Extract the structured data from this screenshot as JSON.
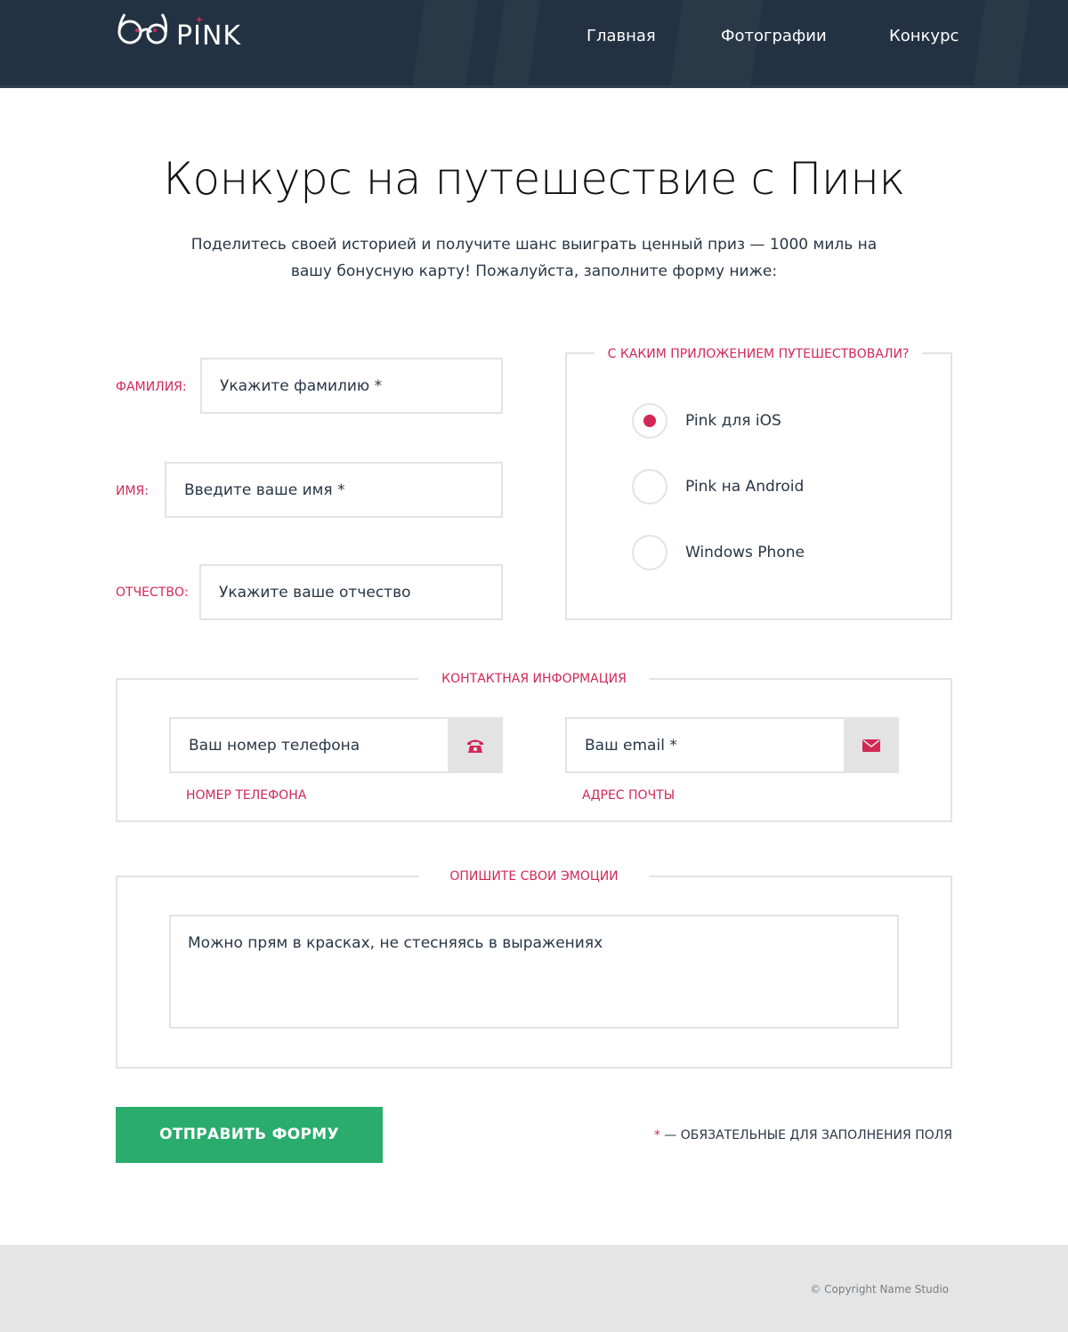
{
  "header": {
    "logo_text": "PINK",
    "nav": [
      {
        "label": "Главная"
      },
      {
        "label": "Фотографии"
      },
      {
        "label": "Конкурс"
      }
    ]
  },
  "intro": {
    "title": "Конкурс на путешествие с Пинк",
    "lead_line1": "Поделитесь своей историей и получите шанс выиграть ценный приз — 1000 миль на",
    "lead_line2": "вашу бонусную карту! Пожалуйста, заполните форму ниже:"
  },
  "personal": {
    "surname_label": "Фамилия:",
    "surname_placeholder": "Укажите фамилию *",
    "name_label": "Имя:",
    "name_placeholder": "Введите ваше имя *",
    "patronymic_label": "Отчество:",
    "patronymic_placeholder": "Укажите ваше отчество"
  },
  "app": {
    "legend": "С каким приложением путешествовали?",
    "options": [
      {
        "label": "Pink для iOS",
        "checked": true
      },
      {
        "label": "Pink на Android",
        "checked": false
      },
      {
        "label": "Windows Phone",
        "checked": false
      }
    ]
  },
  "contacts": {
    "legend": "Контактная информация",
    "phone_placeholder": "Ваш номер телефона",
    "phone_label": "Номер телефона",
    "phone_icon": "phone-icon",
    "email_placeholder": "Ваш email *",
    "email_label": "Адрес почты",
    "email_icon": "mail-icon"
  },
  "emotions": {
    "legend": "Опишите свои эмоции",
    "textarea_placeholder": "Можно прям в красках, не стесняясь в выражениях"
  },
  "form": {
    "submit_label": "Отправить форму",
    "required_star": "*",
    "required_note": " — обязательные для заполнения поля"
  },
  "footer": {
    "copyright": "© Copyright  Name Studio"
  },
  "colors": {
    "accent": "#d22856",
    "header_bg": "#233242",
    "submit_bg": "#2aac6d",
    "border": "#e3e3e3",
    "footer_bg": "#e5e5e5"
  }
}
